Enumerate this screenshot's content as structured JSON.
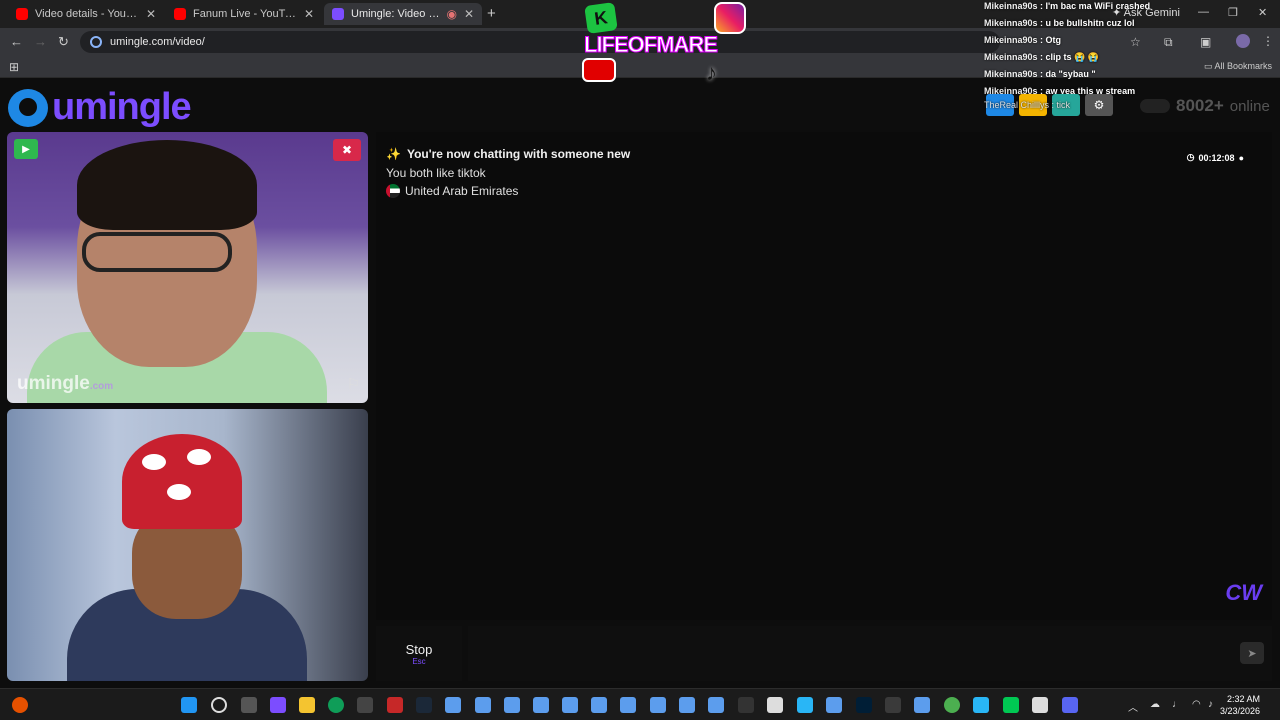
{
  "browser": {
    "tabs": [
      {
        "title": "Video details - YouTube Studio",
        "color": "#ff0000"
      },
      {
        "title": "Fanum Live - YouTube",
        "color": "#ff0000"
      },
      {
        "title": "Umingle: Video Chat with S",
        "color": "#7c4dff"
      }
    ],
    "new_tab": "+",
    "url": "umingle.com/video/",
    "ask_gemini": "Ask Gemini",
    "all_bookmarks": "All Bookmarks"
  },
  "site": {
    "logo_text": "umingle",
    "online_count": "8002+",
    "online_label": "online"
  },
  "video": {
    "watermark": "umingle",
    "watermark_suffix": ".com",
    "play_icon": "play-icon",
    "camera_off_icon": "camera-off-icon"
  },
  "chat": {
    "status_emoji": "✨",
    "status": "You're now chatting with someone new",
    "interests": "You both like tiktok",
    "country": "United Arab Emirates",
    "timer": "00:12:08"
  },
  "controls": {
    "stop_label": "Stop",
    "stop_hint": "Esc"
  },
  "overlay": {
    "logo_text": "LIFEOFMARE",
    "logo_badge": "K",
    "stream_chat": [
      {
        "user": "Mikeinna90s",
        "msg": "I'm bac ma WiFi crashed"
      },
      {
        "user": "Mikeinna90s",
        "msg": "u be bullshitn cuz lol"
      },
      {
        "user": "Mikeinna90s",
        "msg": "Otg"
      },
      {
        "user": "Mikeinna90s",
        "msg": "clip ts 😭 😭"
      },
      {
        "user": "Mikeinna90s",
        "msg": "da \"sybau \""
      },
      {
        "user": "Mikeinna90s",
        "msg": "aw yea this w stream"
      }
    ],
    "sub_alert": "TheReal Chilllys : tick"
  },
  "taskbar": {
    "time": "2:32 AM",
    "date": "3/23/2026"
  },
  "colors": {
    "brand": "#7c4dff",
    "accent_blue": "#1e88e5",
    "play_green": "#2fb84f",
    "camera_off_red": "#d8284a"
  }
}
